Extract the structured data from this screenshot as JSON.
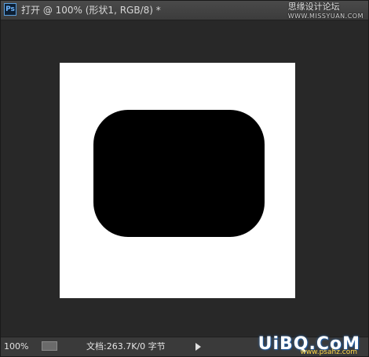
{
  "app": {
    "icon_label": "Ps",
    "document_tab_title": "打开 @ 100% (形状1, RGB/8) *"
  },
  "watermark": {
    "top_text": "思缘设计论坛",
    "top_site": "WWW.MISSYUAN.COM",
    "bottom_text": "UiBQ.CoM",
    "bottom_site": "www.psahz.com"
  },
  "statusbar": {
    "zoom": "100%",
    "doc_info": "文档:263.7K/0 字节"
  },
  "colors": {
    "workspace": "#282828",
    "canvas": "#ffffff",
    "shape_fill": "#000000"
  },
  "icons": {
    "app": "photoshop-icon",
    "status_nav": "navigator-icon",
    "status_menu": "play-arrow-icon"
  }
}
